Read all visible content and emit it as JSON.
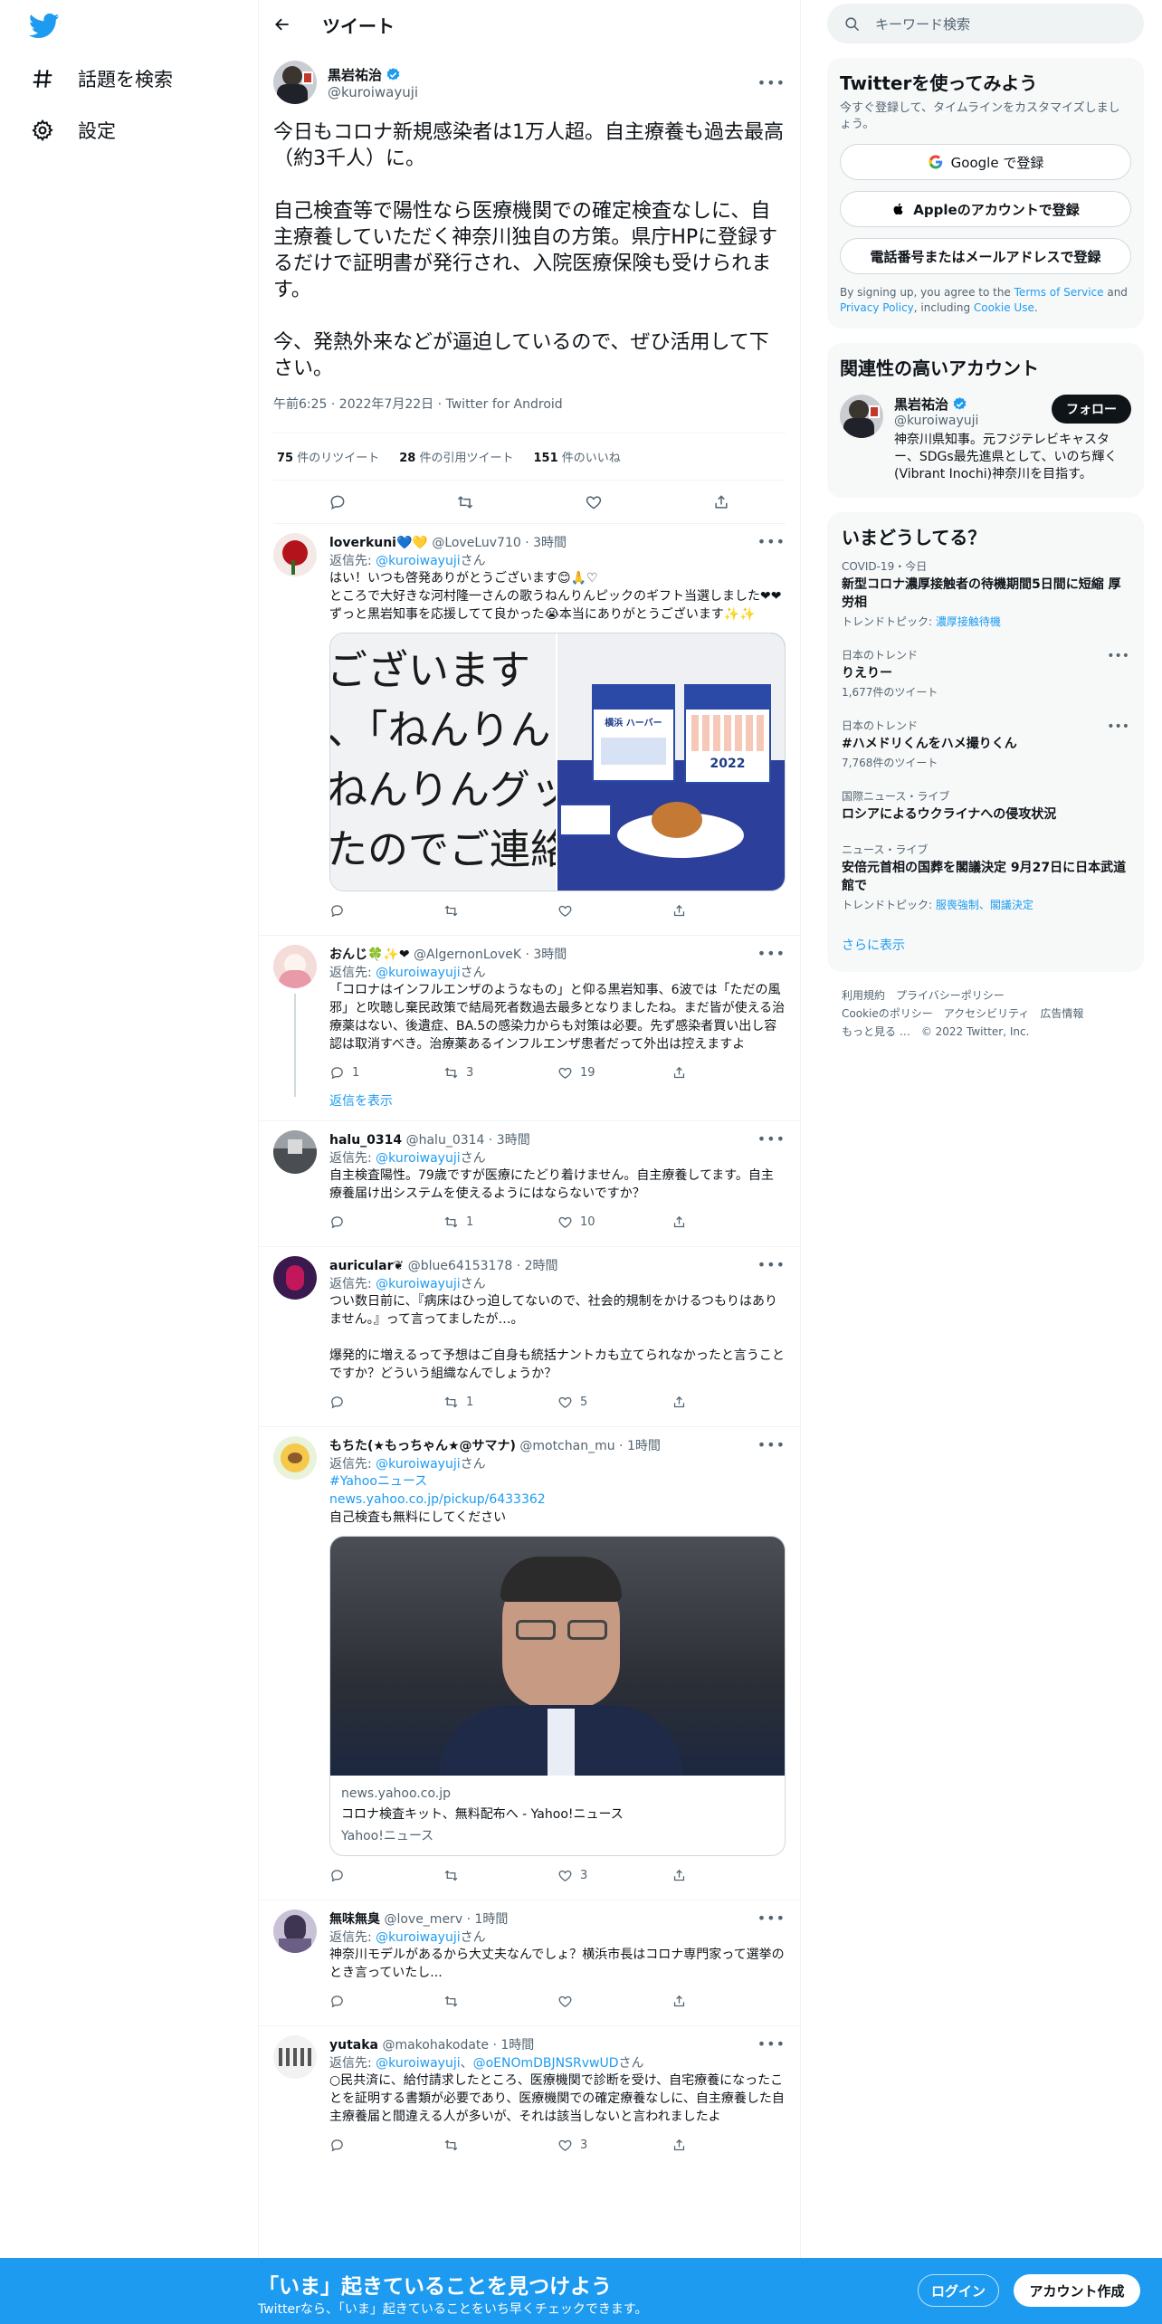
{
  "nav": {
    "explore": "話題を検索",
    "settings": "設定"
  },
  "header": {
    "title": "ツイート"
  },
  "main_tweet": {
    "name": "黒岩祐治",
    "handle": "@kuroiwayuji",
    "text": "今日もコロナ新規感染者は1万人超。自主療養も過去最高（約3千人）に。\n\n自己検査等で陽性なら医療機関での確定検査なしに、自主療養していただく神奈川独自の方策。県庁HPに登録するだけで証明書が発行され、入院医療保険も受けられます。\n\n今、発熱外来などが逼迫しているので、ぜひ活用して下さい。",
    "meta": "午前6:25 · 2022年7月22日 · Twitter for Android",
    "retweets": "75",
    "retweets_label": "件のリツイート",
    "quotes": "28",
    "quotes_label": "件の引用ツイート",
    "likes": "151",
    "likes_label": "件のいいね"
  },
  "reply_to_label": "返信先:",
  "reply_to_suffix": "さん",
  "replies": [
    {
      "name": "loverkuni💙💛",
      "handle": "@LoveLuv710",
      "time": "· 3時間",
      "to": "@kuroiwayuji",
      "text": "はい！いつも啓発ありがとうございます😊🙏♡\nところで大好きな河村隆一さんの歌うねんりんピックのギフト当選しました❤❤\nずっと黒岩知事を応援してて良かった😭本当にありがとうございます✨✨",
      "image_text": "ございます\n、「ねんりん\nねんりんグッ\nたのでご連絡",
      "box_brand": "横浜 ハーバー",
      "box_year": "2022",
      "replies": "",
      "retweets": "",
      "likes": ""
    },
    {
      "name": "おんじ🍀✨❤",
      "handle": "@AlgernonLoveK",
      "time": "· 3時間",
      "to": "@kuroiwayuji",
      "text": "「コロナはインフルエンザのようなもの」と仰る黒岩知事、6波では「ただの風邪」と吹聴し棄民政策で結局死者数過去最多となりましたね。まだ皆が使える治療薬はない、後遺症、BA.5の感染力からも対策は必要。先ず感染者買い出し容認は取消すべき。治療薬あるインフルエンザ患者だって外出は控えますよ",
      "replies": "1",
      "retweets": "3",
      "likes": "19",
      "show_replies": "返信を表示"
    },
    {
      "name": "halu_0314",
      "handle": "@halu_0314",
      "time": "· 3時間",
      "to": "@kuroiwayuji",
      "text": "自主検査陽性。79歳ですが医療にたどり着けません。自主療養してます。自主療養届け出システムを使えるようにはならないですか？",
      "replies": "",
      "retweets": "1",
      "likes": "10"
    },
    {
      "name": "auricular❦",
      "handle": "@blue64153178",
      "time": "· 2時間",
      "to": "@kuroiwayuji",
      "text": "つい数日前に、『病床はひっ迫してないので、社会的規制をかけるつもりはありません。』って言ってましたが…。\n\n爆発的に増えるって予想はご自身も統括ナントカも立てられなかったと言うことですか？どういう組織なんでしょうか？",
      "replies": "",
      "retweets": "1",
      "likes": "5"
    },
    {
      "name": "もちた(★もっちゃん★@サマナ)",
      "handle": "@motchan_mu",
      "time": "· 1時間",
      "to": "@kuroiwayuji",
      "hashtag": "#Yahooニュース",
      "link": "news.yahoo.co.jp/pickup/6433362",
      "text": "自己検査も無料にしてください",
      "card_domain": "news.yahoo.co.jp",
      "card_title": "コロナ検査キット、無料配布へ - Yahoo!ニュース",
      "card_source": "Yahoo!ニュース",
      "replies": "",
      "retweets": "",
      "likes": "3"
    },
    {
      "name": "無味無臭",
      "handle": "@love_merv",
      "time": "· 1時間",
      "to": "@kuroiwayuji",
      "text": "神奈川モデルがあるから大丈夫なんでしょ？横浜市長はコロナ専門家って選挙のとき言っていたし...",
      "replies": "",
      "retweets": "",
      "likes": ""
    },
    {
      "name": "yutaka",
      "handle": "@makohakodate",
      "time": "· 1時間",
      "to": "@kuroiwayuji",
      "to2": "@oENOmDBJNSRvwUD",
      "to_sep": "、",
      "text": "○民共済に、給付請求したところ、医療機関で診断を受け、自宅療養になったことを証明する書類が必要であり、医療機関での確定療養なしに、自主療養した自主療養届と間違える人が多いが、それは該当しないと言われましたよ",
      "replies": "",
      "retweets": "",
      "likes": "3"
    }
  ],
  "right": {
    "search_placeholder": "キーワード検索",
    "signup": {
      "title": "Twitterを使ってみよう",
      "subtitle": "今すぐ登録して、タイムラインをカスタマイズしましょう。",
      "google": "Google で登録",
      "apple": "Appleのアカウントで登録",
      "phone": "電話番号またはメールアドレスで登録",
      "legal_1": "By signing up, you agree to the ",
      "tos": "Terms of Service",
      "legal_2": " and ",
      "privacy": "Privacy Policy",
      "legal_3": ", including ",
      "cookie": "Cookie Use",
      "legal_4": "."
    },
    "related": {
      "title": "関連性の高いアカウント",
      "name": "黒岩祐治",
      "handle": "@kuroiwayuji",
      "follow": "フォロー",
      "bio": "神奈川県知事。元フジテレビキャスター、SDGs最先進県として、いのち輝く(Vibrant Inochi)神奈川を目指す。"
    },
    "trends": {
      "title": "いまどうしてる？",
      "items": [
        {
          "ctx": "COVID-19・今日",
          "title": "新型コロナ濃厚接触者の待機期間5日間に短縮 厚労相",
          "sub_label": "トレンドトピック: ",
          "sub_link": "濃厚接触待機"
        },
        {
          "ctx": "日本のトレンド",
          "title": "りえりー",
          "sub": "1,677件のツイート"
        },
        {
          "ctx": "日本のトレンド",
          "title": "#ハメドリくんをハメ撮りくん",
          "sub": "7,768件のツイート"
        },
        {
          "ctx": "国際ニュース・ライブ",
          "title": "ロシアによるウクライナへの侵攻状況"
        },
        {
          "ctx": "ニュース・ライブ",
          "title": "安倍元首相の国葬を閣議決定 9月27日に日本武道館で",
          "sub_label": "トレンドトピック: ",
          "sub_link": "服喪強制、閣議決定"
        }
      ],
      "show_more": "さらに表示"
    },
    "footer": {
      "terms": "利用規約",
      "privacy": "プライバシーポリシー",
      "cookie": "Cookieのポリシー",
      "accessibility": "アクセシビリティ",
      "ads": "広告情報",
      "more": "もっと見る …",
      "copyright": "© 2022 Twitter, Inc."
    }
  },
  "bottom_bar": {
    "title": "「いま」起きていることを見つけよう",
    "subtitle": "Twitterなら、「いま」起きていることをいち早くチェックできます。",
    "login": "ログイン",
    "signup": "アカウント作成"
  },
  "colors": {
    "accent": "#1d9bf0",
    "text": "#0f1419",
    "secondary": "#536471",
    "border": "#eff3f4"
  },
  "icons": [
    "twitter-logo-icon",
    "hashtag-icon",
    "gear-icon",
    "back-arrow-icon",
    "verified-icon",
    "reply-icon",
    "retweet-icon",
    "like-icon",
    "share-icon",
    "search-icon",
    "google-icon",
    "apple-icon"
  ]
}
